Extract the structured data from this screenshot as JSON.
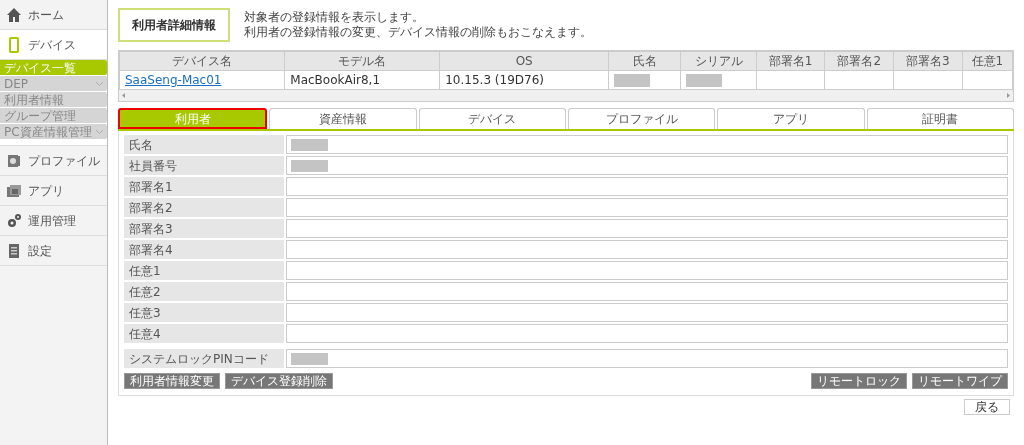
{
  "sidebar": {
    "items": [
      {
        "label": "ホーム",
        "kind": "home",
        "selected": false
      },
      {
        "label": "デバイス",
        "kind": "device",
        "selected": true,
        "children": [
          {
            "label": "デバイス一覧",
            "selected": true,
            "expandable": false
          },
          {
            "label": "DEP",
            "selected": false,
            "expandable": true
          },
          {
            "label": "利用者情報",
            "selected": false,
            "expandable": false
          },
          {
            "label": "グループ管理",
            "selected": false,
            "expandable": false
          },
          {
            "label": "PC資産情報管理",
            "selected": false,
            "expandable": true
          }
        ]
      },
      {
        "label": "プロファイル",
        "kind": "profile",
        "selected": false
      },
      {
        "label": "アプリ",
        "kind": "app",
        "selected": false
      },
      {
        "label": "運用管理",
        "kind": "gears",
        "selected": false
      },
      {
        "label": "設定",
        "kind": "settings",
        "selected": false
      }
    ]
  },
  "header": {
    "title": "利用者詳細情報",
    "description": [
      "対象者の登録情報を表示します。",
      "利用者の登録情報の変更、デバイス情報の削除もおこなえます。"
    ]
  },
  "table": {
    "columns": [
      "デバイス名",
      "モデル名",
      "OS",
      "氏名",
      "シリアル",
      "部署名1",
      "部署名2",
      "部署名3",
      "任意1"
    ],
    "rows": [
      [
        {
          "text": "SaaSeng-Mac01",
          "link": true
        },
        {
          "text": "MacBookAir8,1"
        },
        {
          "text": "10.15.3 (19D76)"
        },
        {
          "redacted": true
        },
        {
          "redacted": true
        },
        {},
        {},
        {},
        {}
      ]
    ]
  },
  "tabs": [
    {
      "label": "利用者",
      "selected": true
    },
    {
      "label": "資産情報",
      "selected": false
    },
    {
      "label": "デバイス",
      "selected": false
    },
    {
      "label": "プロファイル",
      "selected": false
    },
    {
      "label": "アプリ",
      "selected": false
    },
    {
      "label": "証明書",
      "selected": false
    }
  ],
  "fields": [
    {
      "label": "氏名",
      "redacted": true
    },
    {
      "label": "社員番号",
      "redacted": true
    },
    {
      "label": "部署名1",
      "redacted": false
    },
    {
      "label": "部署名2",
      "redacted": false
    },
    {
      "label": "部署名3",
      "redacted": false
    },
    {
      "label": "部署名4",
      "redacted": false
    },
    {
      "label": "任意1",
      "redacted": false
    },
    {
      "label": "任意2",
      "redacted": false
    },
    {
      "label": "任意3",
      "redacted": false
    },
    {
      "label": "任意4",
      "redacted": false
    }
  ],
  "pin_field": {
    "label": "システムロックPINコード",
    "redacted": true
  },
  "left_buttons": [
    "利用者情報変更",
    "デバイス登録削除"
  ],
  "right_buttons": [
    "リモートロック",
    "リモートワイプ"
  ],
  "back_button": "戻る"
}
